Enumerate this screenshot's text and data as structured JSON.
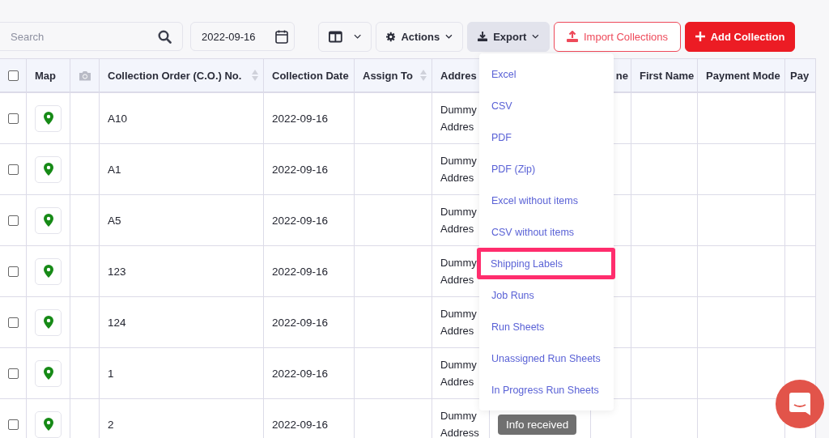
{
  "toolbar": {
    "search": {
      "placeholder": "Search"
    },
    "date": {
      "value": "2022-09-16"
    },
    "buttons": [
      {
        "kind": "columns"
      },
      {
        "kind": "actions",
        "label": "Actions",
        "active": false
      },
      {
        "kind": "export",
        "label": "Export",
        "active": true
      },
      {
        "kind": "import",
        "label": "Import Collections",
        "active": false
      },
      {
        "kind": "add",
        "label": "Add Collection",
        "active": false
      }
    ]
  },
  "export_menu": {
    "items": [
      {
        "label": "Excel",
        "highlighted": false
      },
      {
        "label": "CSV",
        "highlighted": false
      },
      {
        "label": "PDF",
        "highlighted": false
      },
      {
        "label": "PDF (Zip)",
        "highlighted": false
      },
      {
        "label": "Excel without items",
        "highlighted": false
      },
      {
        "label": "CSV without items",
        "highlighted": false
      },
      {
        "label": "Shipping Labels",
        "highlighted": true
      },
      {
        "label": "Job Runs",
        "highlighted": false
      },
      {
        "label": "Run Sheets",
        "highlighted": false
      },
      {
        "label": "Unassigned Run Sheets",
        "highlighted": false
      },
      {
        "label": "In Progress Run Sheets",
        "highlighted": false
      }
    ]
  },
  "table": {
    "columns": [
      {
        "kind": "checkbox",
        "checked": false
      },
      {
        "kind": "text",
        "label": "Map",
        "sortable": false
      },
      {
        "kind": "camera"
      },
      {
        "kind": "text",
        "label": "Collection Order (C.O.) No.",
        "sortable": true
      },
      {
        "kind": "text",
        "label": "Collection Date",
        "sortable": false
      },
      {
        "kind": "text",
        "label": "Assign To",
        "sortable": true
      },
      {
        "kind": "text",
        "label": "Addres",
        "sortable": false
      },
      {
        "kind": "blank"
      },
      {
        "kind": "text",
        "label": "ne",
        "sortable": false
      },
      {
        "kind": "text",
        "label": "First Name",
        "sortable": false
      },
      {
        "kind": "text",
        "label": "Payment Mode",
        "sortable": false
      },
      {
        "kind": "text",
        "label": "Pay",
        "sortable": false
      }
    ],
    "rows": [
      {
        "checked": false,
        "co_no": "A10",
        "date": "2022-09-16",
        "address": "Dummy Addres"
      },
      {
        "checked": false,
        "co_no": "A1",
        "date": "2022-09-16",
        "address": "Dummy Addres"
      },
      {
        "checked": false,
        "co_no": "A5",
        "date": "2022-09-16",
        "address": "Dummy Addres"
      },
      {
        "checked": false,
        "co_no": "123",
        "date": "2022-09-16",
        "address": "Dummy Addres"
      },
      {
        "checked": false,
        "co_no": "124",
        "date": "2022-09-16",
        "address": "Dummy Addres"
      },
      {
        "checked": false,
        "co_no": "1",
        "date": "2022-09-16",
        "address": "Dummy Addres"
      },
      {
        "checked": false,
        "co_no": "2",
        "date": "2022-09-16",
        "address": "Dummy Address",
        "status": "Info received"
      }
    ]
  }
}
